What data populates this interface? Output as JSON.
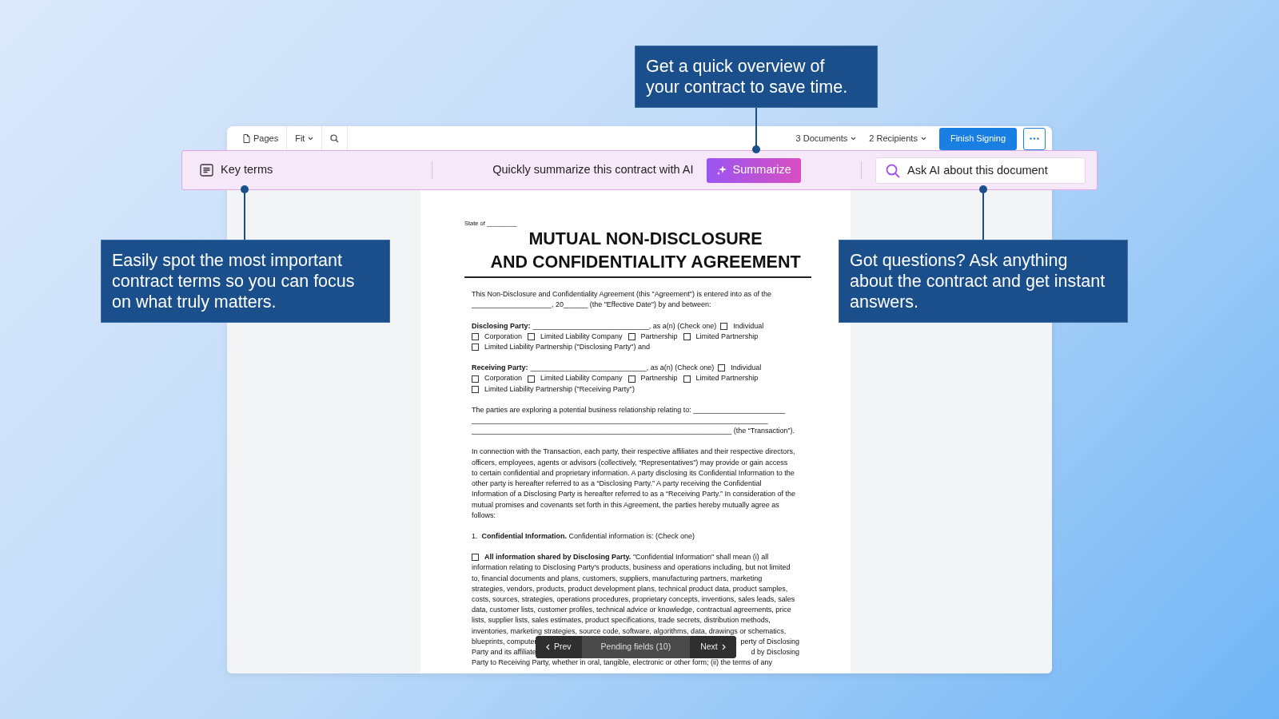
{
  "toolbar": {
    "left": [
      {
        "label": "Pages",
        "kind": "pages"
      },
      {
        "label": "Fit",
        "kind": "dropdown"
      },
      {
        "kind": "search"
      }
    ],
    "right": [
      {
        "label": "3 Documents",
        "kind": "dropdown"
      },
      {
        "label": "2 Recipients",
        "kind": "dropdown"
      }
    ],
    "primary_button": "Finish Signing"
  },
  "ai_bar": {
    "key_terms": "Key terms",
    "prompt": "Quickly summarize this contract with AI",
    "summarize_button": "Summarize",
    "search": {
      "placeholder": "Ask AI about this document"
    }
  },
  "callouts": [
    {
      "text": "Get a quick overview of your contract to save time.",
      "kind": "top"
    },
    {
      "text": "Easily spot the most important contract terms so you can focus on what truly matters.",
      "kind": "left"
    },
    {
      "text": "Got questions? Ask anything about the contract and get instant answers.",
      "kind": "right"
    }
  ],
  "document": {
    "state": "State of _________",
    "title_lines": [
      "MUTUAL NON-DISCLOSURE",
      "AND CONFIDENTIALITY AGREEMENT"
    ],
    "blocks": [
      {
        "kind": "lines",
        "lines": [
          {
            "text": "This Non-Disclosure and Confidentiality Agreement (this \"Agreement\") is entered into as of the"
          },
          {
            "text": "____________________, 20______ (the \"Effective Date\") by and between:"
          }
        ]
      },
      {
        "kind": "party",
        "label": "Disclosing Party:",
        "text": "_____________________________, as a(n) (Check one)",
        "option_rows": [
          [
            {
              "label": "Individual",
              "checked": false
            }
          ],
          [
            {
              "label": "Corporation",
              "checked": false
            },
            {
              "label": "Limited Liability Company",
              "checked": false
            },
            {
              "label": "Partnership",
              "checked": false
            },
            {
              "label": "Limited Partnership",
              "checked": false
            }
          ],
          [
            {
              "label": "Limited Liability Partnership (\"Disclosing Party\") and",
              "checked": false
            }
          ]
        ]
      },
      {
        "kind": "party",
        "label": "Receiving Party:",
        "text": "_____________________________, as a(n) (Check one)",
        "option_rows": [
          [
            {
              "label": "Individual",
              "checked": false
            }
          ],
          [
            {
              "label": "Corporation",
              "checked": false
            },
            {
              "label": "Limited Liability Company",
              "checked": false
            },
            {
              "label": "Partnership",
              "checked": false
            },
            {
              "label": "Limited Partnership",
              "checked": false
            }
          ],
          [
            {
              "label": "Limited Liability Partnership (\"Receiving Party\")",
              "checked": false
            }
          ]
        ]
      },
      {
        "kind": "lines",
        "lines": [
          {
            "text": "The parties are exploring a potential business relationship relating to: _______________________"
          },
          {
            "text": "__________________________________________________________________________"
          },
          {
            "text": "_________________________________________________________________ (the “Transaction”)."
          }
        ]
      },
      {
        "kind": "lines",
        "lines": [
          {
            "text": "In connection with the Transaction, each party, their respective affiliates and their respective directors,"
          },
          {
            "text": "officers, employees, agents or advisors (collectively, “Representatives”) may provide or gain access"
          },
          {
            "text": "to certain confidential and proprietary information. A party disclosing its Confidential Information to the"
          },
          {
            "text": "other party is hereafter referred to as a “Disclosing Party.” A party receiving the Confidential"
          },
          {
            "text": "Information of a Disclosing Party is hereafter referred to as a “Receiving Party.” In consideration of the"
          },
          {
            "text": "mutual promises and covenants set forth in this Agreement, the parties hereby mutually agree as"
          },
          {
            "text": "follows:"
          }
        ]
      },
      {
        "kind": "numbered",
        "number": "1.",
        "text": "**Confidential Information.** Confidential information is: (Check one)"
      },
      {
        "kind": "lines",
        "lines": [
          {
            "text": "**All information shared by Disclosing Party.** \"Confidential Information\" shall mean (i) all",
            "checkbox": {
              "checked": false
            }
          },
          {
            "text": "information relating to Disclosing Party's products, business and operations including, but not limited"
          },
          {
            "text": "to, financial documents and plans, customers, suppliers, manufacturing partners, marketing"
          },
          {
            "text": "strategies, vendors, products, product development plans, technical product data, product samples,"
          },
          {
            "text": "costs, sources, strategies, operations procedures, proprietary concepts, inventions, sales leads, sales"
          },
          {
            "text": "data, customer lists, customer profiles, technical advice or knowledge, contractual agreements, price"
          },
          {
            "text": "lists, supplier lists, sales estimates, product specifications, trade secrets, distribution methods,"
          },
          {
            "text": "inventories, marketing strategies, source code, software, algorithms, data, drawings or schematics,"
          },
          {
            "left": "blueprints, computer",
            "right": "perty of Disclosing"
          },
          {
            "left": "Party and its affiliate",
            "right": "d by Disclosing"
          },
          {
            "text": "Party to Receiving Party, whether in oral, tangible, electronic or other form; (ii) the terms of any"
          }
        ]
      }
    ]
  },
  "pending_bar": {
    "prev": "Prev",
    "label": "Pending fields (10)",
    "next": "Next"
  }
}
